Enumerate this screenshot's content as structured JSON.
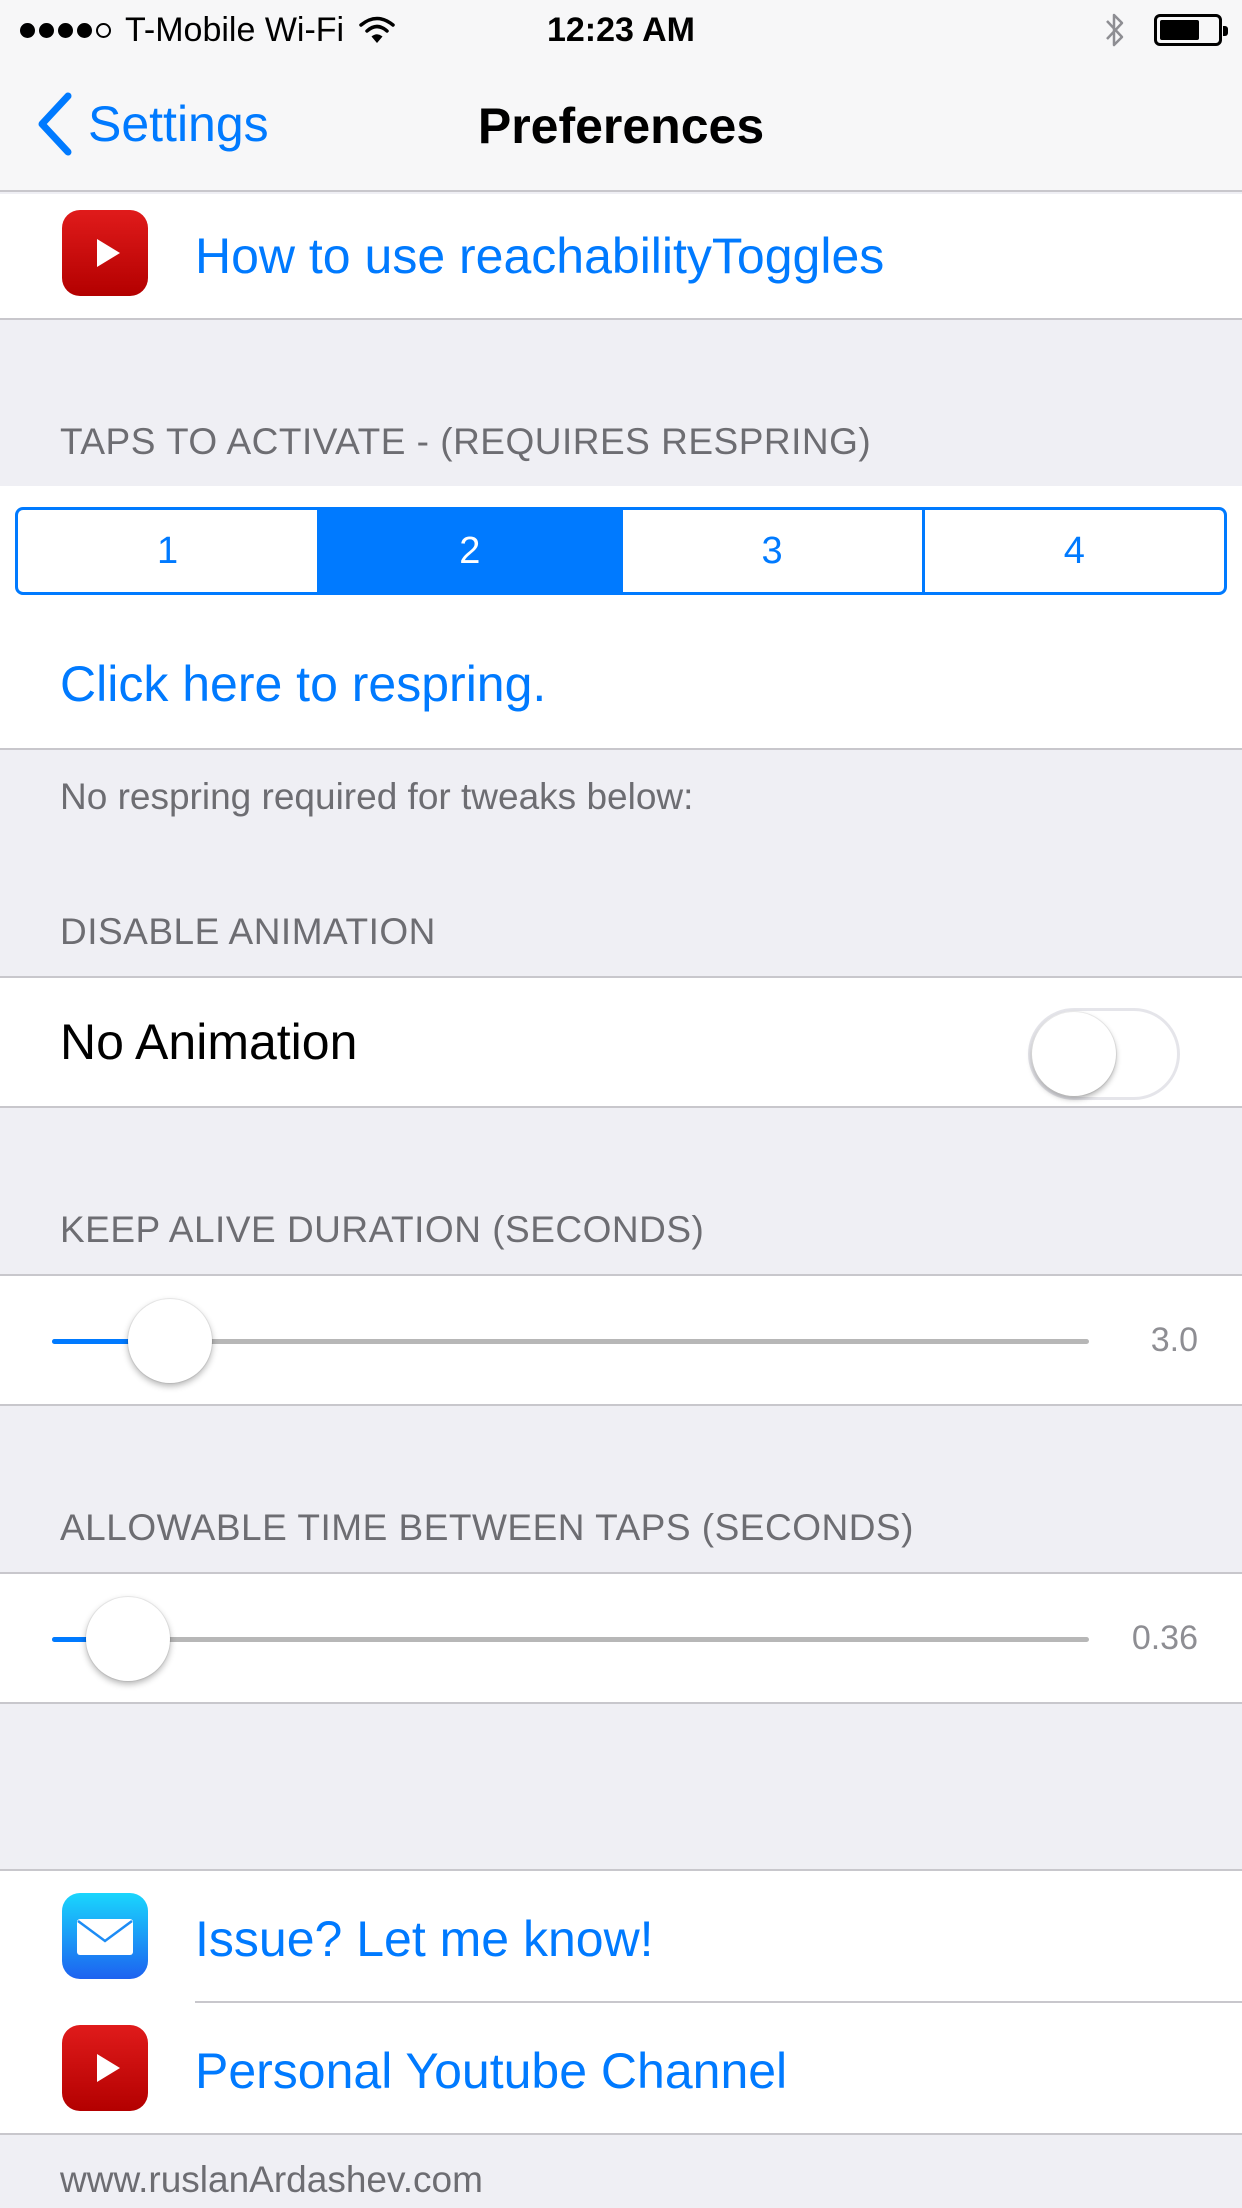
{
  "status_bar": {
    "carrier": "T-Mobile Wi-Fi",
    "time": "12:23 AM",
    "signal_bars_filled": 4,
    "signal_bars_total": 5,
    "battery_level": 0.7
  },
  "nav": {
    "back_label": "Settings",
    "title": "Preferences"
  },
  "links_top": {
    "how_to_label": "How to use reachabilityToggles"
  },
  "taps_section": {
    "header": "TAPS TO ACTIVATE - (REQUIRES RESPRING)",
    "segments": [
      "1",
      "2",
      "3",
      "4"
    ],
    "selected_index": 1,
    "respring_label": "Click here to respring."
  },
  "no_respring_note": "No respring required for tweaks below:",
  "animation_section": {
    "header": "DISABLE ANIMATION",
    "toggle_label": "No Animation",
    "toggle_on": false
  },
  "keep_alive_section": {
    "header": "KEEP ALIVE DURATION (SECONDS)",
    "value_text": "3.0",
    "fraction": 0.114
  },
  "tap_interval_section": {
    "header": "ALLOWABLE TIME BETWEEN TAPS (SECONDS)",
    "value_text": "0.36",
    "fraction": 0.073
  },
  "links_bottom": {
    "issue_label": "Issue? Let me know!",
    "youtube_label": "Personal Youtube Channel"
  },
  "footer": "www.ruslanArdashev.com",
  "colors": {
    "accent": "#007aff",
    "background": "#efeff4",
    "youtube_red": "#cc0000",
    "mail_blue": "#1d8cf5"
  },
  "icons": {
    "back": "chevron-left-icon",
    "youtube": "youtube-play-icon",
    "mail": "mail-envelope-icon",
    "wifi": "wifi-icon",
    "bluetooth": "bluetooth-icon",
    "battery": "battery-icon"
  }
}
